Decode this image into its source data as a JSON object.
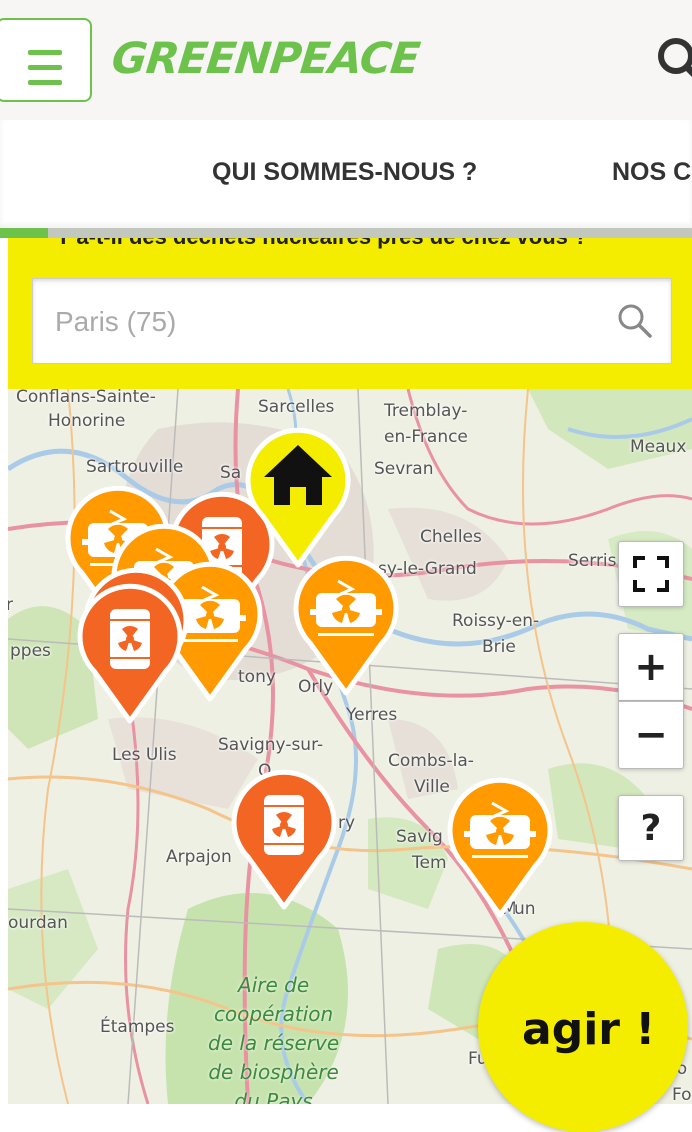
{
  "header": {
    "logo_text": "GREENPEACE",
    "menu_icon": "hamburger-icon",
    "search_icon": "search-icon",
    "brand_color": "#6cc24a"
  },
  "nav": {
    "items": [
      {
        "label": "QUI SOMMES-NOUS ?"
      },
      {
        "label": "NOS C"
      }
    ]
  },
  "search_panel": {
    "question": "Y a-t-il des déchets nucléaires près de chez vous ?",
    "placeholder": "Paris (75)",
    "search_icon": "search-icon",
    "background_color": "#f5ed00"
  },
  "map": {
    "places": [
      "Conflans-Sainte-",
      "Honorine",
      "Sarcelles",
      "Tremblay-",
      "en-France",
      "Meaux",
      "Sartrouville",
      "Sa",
      "Sevran",
      "Chelles",
      "sy-le-Grand",
      "Serris",
      "r",
      "ppes",
      "Roissy-en-",
      "Brie",
      "tony",
      "Orly",
      "Yerres",
      "Les Ulis",
      "Savigny-sur-",
      "O",
      "Combs-la-",
      "Ville",
      "Arpajon",
      "ry",
      "Savig",
      "Tem",
      "M",
      "un",
      "ourdan",
      "Étampes",
      "Fu",
      "lo",
      "Fo"
    ],
    "park_label": [
      "Aire de",
      "coopération",
      "de la réserve",
      "de biosphère",
      "du Pays"
    ],
    "markers": [
      {
        "type": "home",
        "icon": "house-icon",
        "color": "#f5ed00"
      },
      {
        "type": "train",
        "icon": "nuclear-train-icon",
        "color": "#ff9a00"
      },
      {
        "type": "train",
        "icon": "nuclear-train-icon",
        "color": "#ff9a00"
      },
      {
        "type": "train",
        "icon": "nuclear-train-icon",
        "color": "#ff9a00"
      },
      {
        "type": "train",
        "icon": "nuclear-train-icon",
        "color": "#ff9a00"
      },
      {
        "type": "train",
        "icon": "nuclear-train-icon",
        "color": "#ff9a00"
      },
      {
        "type": "barrel",
        "icon": "nuclear-barrel-icon",
        "color": "#f26522"
      },
      {
        "type": "barrel",
        "icon": "nuclear-barrel-icon",
        "color": "#f26522"
      },
      {
        "type": "barrel",
        "icon": "nuclear-barrel-icon",
        "color": "#f26522"
      },
      {
        "type": "barrel",
        "icon": "nuclear-barrel-icon",
        "color": "#f26522"
      }
    ],
    "controls": {
      "fullscreen_icon": "fullscreen-icon",
      "zoom_in": "+",
      "zoom_out": "−",
      "help": "?"
    }
  },
  "cta": {
    "label": "agir !",
    "color": "#f5ed00"
  }
}
